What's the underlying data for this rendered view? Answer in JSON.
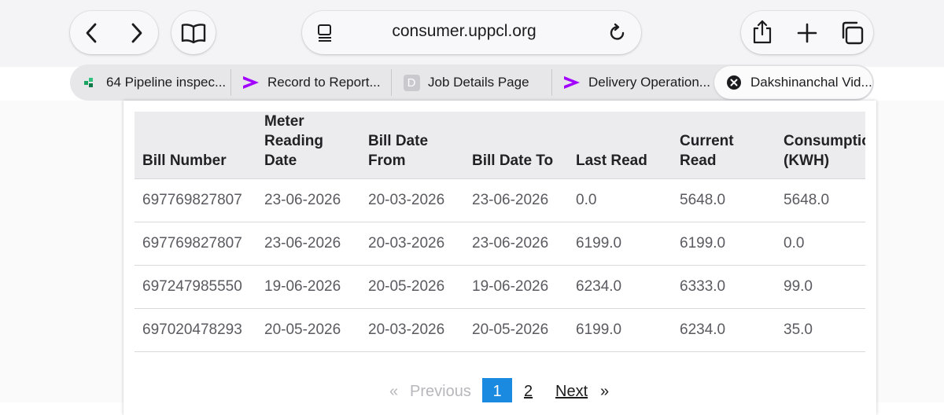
{
  "browser": {
    "url": "consumer.uppcl.org",
    "icons": {
      "back": "chevron-left-icon",
      "forward": "chevron-right-icon",
      "bookmarks": "book-icon",
      "reader": "page-menu-icon",
      "reload": "reload-icon",
      "share": "share-icon",
      "new_tab": "plus-icon",
      "tabs": "tab-overview-icon"
    },
    "tabs": [
      {
        "title": "64 Pipeline inspec...",
        "favicon": "green-pipeline-favicon"
      },
      {
        "title": "Record to Report...",
        "favicon": "accenture-chevron-favicon"
      },
      {
        "title": "Job Details Page",
        "favicon": "D"
      },
      {
        "title": "Delivery Operation...",
        "favicon": "accenture-chevron-favicon"
      },
      {
        "title": "Dakshinanchal Vid...",
        "favicon": "close-tab-icon",
        "active": true
      }
    ]
  },
  "table": {
    "headers": [
      "Bill Number",
      "Meter Reading Date",
      "Bill Date From",
      "Bill Date To",
      "Last Read",
      "Current Read",
      "Consumption (KWH)"
    ],
    "rows": [
      [
        "697769827807",
        "23-06-2026",
        "20-03-2026",
        "23-06-2026",
        "0.0",
        "5648.0",
        "5648.0"
      ],
      [
        "697769827807",
        "23-06-2026",
        "20-03-2026",
        "23-06-2026",
        "6199.0",
        "6199.0",
        "0.0"
      ],
      [
        "697247985550",
        "19-06-2026",
        "20-05-2026",
        "19-06-2026",
        "6234.0",
        "6333.0",
        "99.0"
      ],
      [
        "697020478293",
        "20-05-2026",
        "20-03-2026",
        "20-05-2026",
        "6199.0",
        "6234.0",
        "35.0"
      ]
    ]
  },
  "pagination": {
    "prev_symbol": "«",
    "prev_label": "Previous",
    "pages": [
      "1",
      "2"
    ],
    "current": "1",
    "next_label": "Next",
    "next_symbol": "»"
  },
  "colors": {
    "accent": "#1a8ae0",
    "accenture_purple": "#a100ff"
  }
}
